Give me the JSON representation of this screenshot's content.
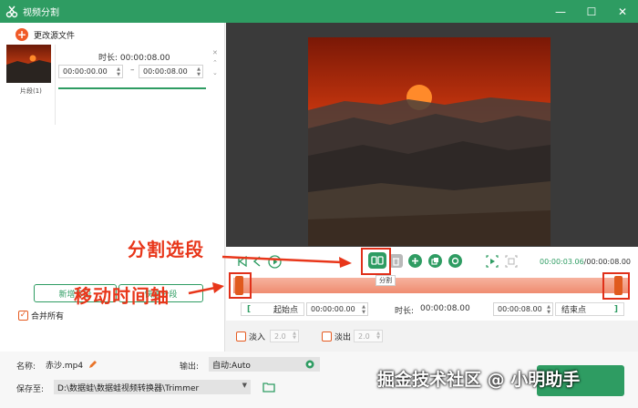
{
  "app": {
    "title": "视频分割"
  },
  "window_controls": {
    "minimize": "—",
    "maximize": "☐",
    "close": "✕"
  },
  "left": {
    "change_source": "更改源文件",
    "segment_label": "片段(1)",
    "duration_label": "时长:",
    "duration_value": "00:00:08.00",
    "start_time": "00:00:00.00",
    "end_time": "00:00:08.00",
    "dash": "–",
    "add_segment": "新增片段",
    "quick_split": "快速分段",
    "merge_all": "合并所有"
  },
  "player": {
    "current_time": "00:00:03.06",
    "total_time": "/00:00:08.00",
    "tooltip_split": "分割"
  },
  "segment_controls": {
    "start_point": "起始点",
    "start_value": "00:00:00.00",
    "duration_label": "时长:",
    "duration_value": "00:00:08.00",
    "end_value": "00:00:08.00",
    "end_point": "结束点",
    "fade_in": "淡入",
    "fade_in_value": "2.0",
    "fade_out": "淡出",
    "fade_out_value": "2.0"
  },
  "bottom": {
    "name_label": "名称:",
    "name_value": "赤沙.mp4",
    "output_label": "输出:",
    "output_value": "自动:Auto",
    "save_label": "保存至:",
    "save_path": "D:\\数据蛙\\数据蛙视频转换器\\Trimmer"
  },
  "annotations": {
    "split_segment": "分割选段",
    "move_timeline": "移动时间轴",
    "watermark": "掘金技术社区 @ 小明助手"
  },
  "colors": {
    "accent": "#2e9c62",
    "annotation": "#e8361a"
  }
}
